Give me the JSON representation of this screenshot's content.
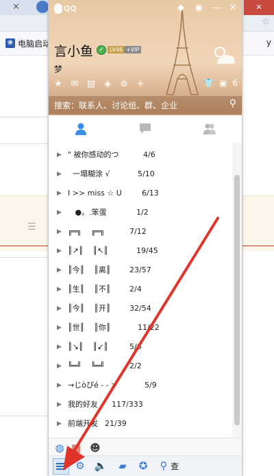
{
  "browser": {
    "bookmark_label": "电脑启动",
    "bookmark_right": "y"
  },
  "qq": {
    "logo_text": "QQ",
    "nickname": "言小鱼",
    "level_badge": "LV46",
    "vip_badge": "+VIP",
    "signature": "梦",
    "mail_count": "6",
    "search_placeholder": "搜索：联系人、讨论组、群、企业",
    "groups": [
      {
        "name": "\" 被你感动的つ",
        "count": "4/6"
      },
      {
        "name": "  一塌糊涂 √",
        "count": "5/10"
      },
      {
        "name": "I >> miss ☆ U",
        "count": "6/13"
      },
      {
        "name": "   ●。.笨蛋",
        "count": "1/2"
      },
      {
        "name": "╔═╗    ╔═╗",
        "count": "7/12"
      },
      {
        "name": "║↗║    ║↖║",
        "count": "19/45"
      },
      {
        "name": "║今║    ║离║",
        "count": "23/57"
      },
      {
        "name": "║生║    ║不║",
        "count": "2/4"
      },
      {
        "name": "║今║    ║开║",
        "count": "32/54"
      },
      {
        "name": "║世║    ║你║",
        "count": "11/22"
      },
      {
        "name": "║↘║    ║↙║",
        "count": "5/6"
      },
      {
        "name": "╚═╝    ╚═╝",
        "count": "2/2"
      },
      {
        "name": "→じòぴé - - >",
        "count": "5/9"
      },
      {
        "name": "我的好友",
        "count": "117/333"
      },
      {
        "name": "前端开发",
        "count": "21/39"
      }
    ],
    "find_label": "查"
  },
  "colors": {
    "annotation_red": "#e0342b",
    "accent_blue": "#3a7bd5"
  }
}
